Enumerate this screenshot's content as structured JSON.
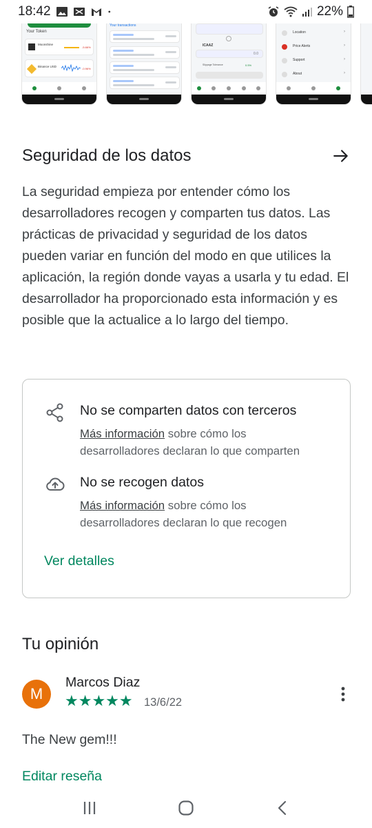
{
  "status_bar": {
    "time": "18:42",
    "battery": "22%",
    "icons_left": [
      "image-icon",
      "voicemail-icon",
      "gmail-icon",
      "dot-icon"
    ],
    "icons_right": [
      "alarm-icon",
      "wifi-icon",
      "signal-icon",
      "battery-icon"
    ]
  },
  "screenshots": {
    "shot1": {
      "label": "Your Token",
      "row1": "Moonshine",
      "row1_change": "-5.66%",
      "row2": "Binance USD",
      "row2_change": "-0.96%"
    },
    "shot2": {
      "label": "Your transactions"
    },
    "shot3": {
      "ticker": "ICAAZ",
      "swap_value": "0.0",
      "slippage": "Slippage Tolerance",
      "slippage_value": "0.5%"
    },
    "shot4": {
      "items": [
        "Location",
        "Price Alerts",
        "Support",
        "About"
      ]
    }
  },
  "data_safety": {
    "title": "Seguridad de los datos",
    "description": "La seguridad empieza por entender cómo los desarrolladores recogen y comparten tus datos. Las prácticas de privacidad y seguridad de los datos pueden variar en función del modo en que utilices la aplicación, la región donde vayas a usarla y tu edad. El desarrollador ha proporcionado esta información y es posible que la actualice a lo largo del tiempo.",
    "items": [
      {
        "icon": "share-icon",
        "heading": "No se comparten datos con terceros",
        "link": "Más información",
        "sub_line1": " sobre cómo los",
        "sub_line2": "desarrolladores declaran lo que comparten"
      },
      {
        "icon": "cloud-upload-icon",
        "heading": "No se recogen datos",
        "link": "Más información",
        "sub_line1": " sobre cómo los",
        "sub_line2": "desarrolladores declaran lo que recogen"
      }
    ],
    "details_link": "Ver detalles"
  },
  "review": {
    "title": "Tu opinión",
    "avatar_letter": "M",
    "author": "Marcos Diaz",
    "stars": "★★★★★",
    "rating": 5,
    "date": "13/6/22",
    "text": "The New gem!!!",
    "edit_label": "Editar reseña"
  },
  "colors": {
    "accent": "#01875f",
    "avatar": "#e8710a",
    "text_primary": "#202124",
    "text_secondary": "#5f6368"
  }
}
